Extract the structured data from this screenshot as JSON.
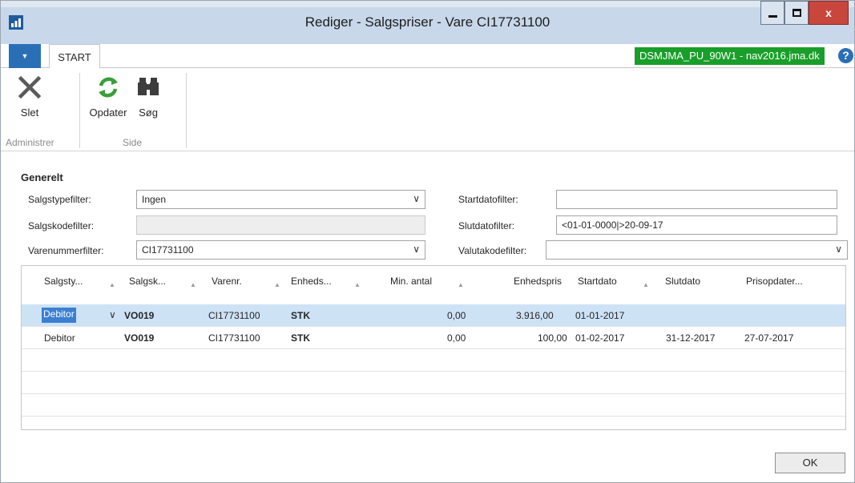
{
  "window": {
    "title": "Rediger - Salgspriser - Vare CI17731100",
    "close_label": "x"
  },
  "tabs": {
    "start_label": "START",
    "server_badge": "DSMJMA_PU_90W1 - nav2016.jma.dk",
    "help_label": "?"
  },
  "ribbon": {
    "buttons": {
      "delete": "Slet",
      "refresh": "Opdater",
      "search": "Søg"
    },
    "groups": {
      "manage": "Administrer",
      "page": "Side"
    }
  },
  "form": {
    "section_title": "Generelt",
    "sales_type_filter": {
      "label": "Salgstypefilter:",
      "value": "Ingen"
    },
    "sales_code_filter": {
      "label": "Salgskodefilter:",
      "value": ""
    },
    "item_no_filter": {
      "label": "Varenummerfilter:",
      "value": "CI17731100"
    },
    "start_date_filter": {
      "label": "Startdatofilter:",
      "value": ""
    },
    "end_date_filter": {
      "label": "Slutdatofilter:",
      "value": "<01-01-0000|>20-09-17"
    },
    "currency_filter": {
      "label": "Valutakodefilter:",
      "value": ""
    }
  },
  "grid": {
    "columns": [
      "Salgsty...",
      "Salgsk...",
      "Varenr.",
      "Enheds...",
      "Min. antal",
      "Enhedspris",
      "Startdato",
      "Slutdato",
      "Prisopdater..."
    ],
    "rows": [
      [
        "Debitor",
        "VO019",
        "CI17731100",
        "STK",
        "0,00",
        "3.916,00",
        "01-01-2017",
        "",
        ""
      ],
      [
        "Debitor",
        "VO019",
        "CI17731100",
        "STK",
        "0,00",
        "100,00",
        "01-02-2017",
        "31-12-2017",
        "27-07-2017"
      ]
    ]
  },
  "footer": {
    "ok_label": "OK"
  }
}
